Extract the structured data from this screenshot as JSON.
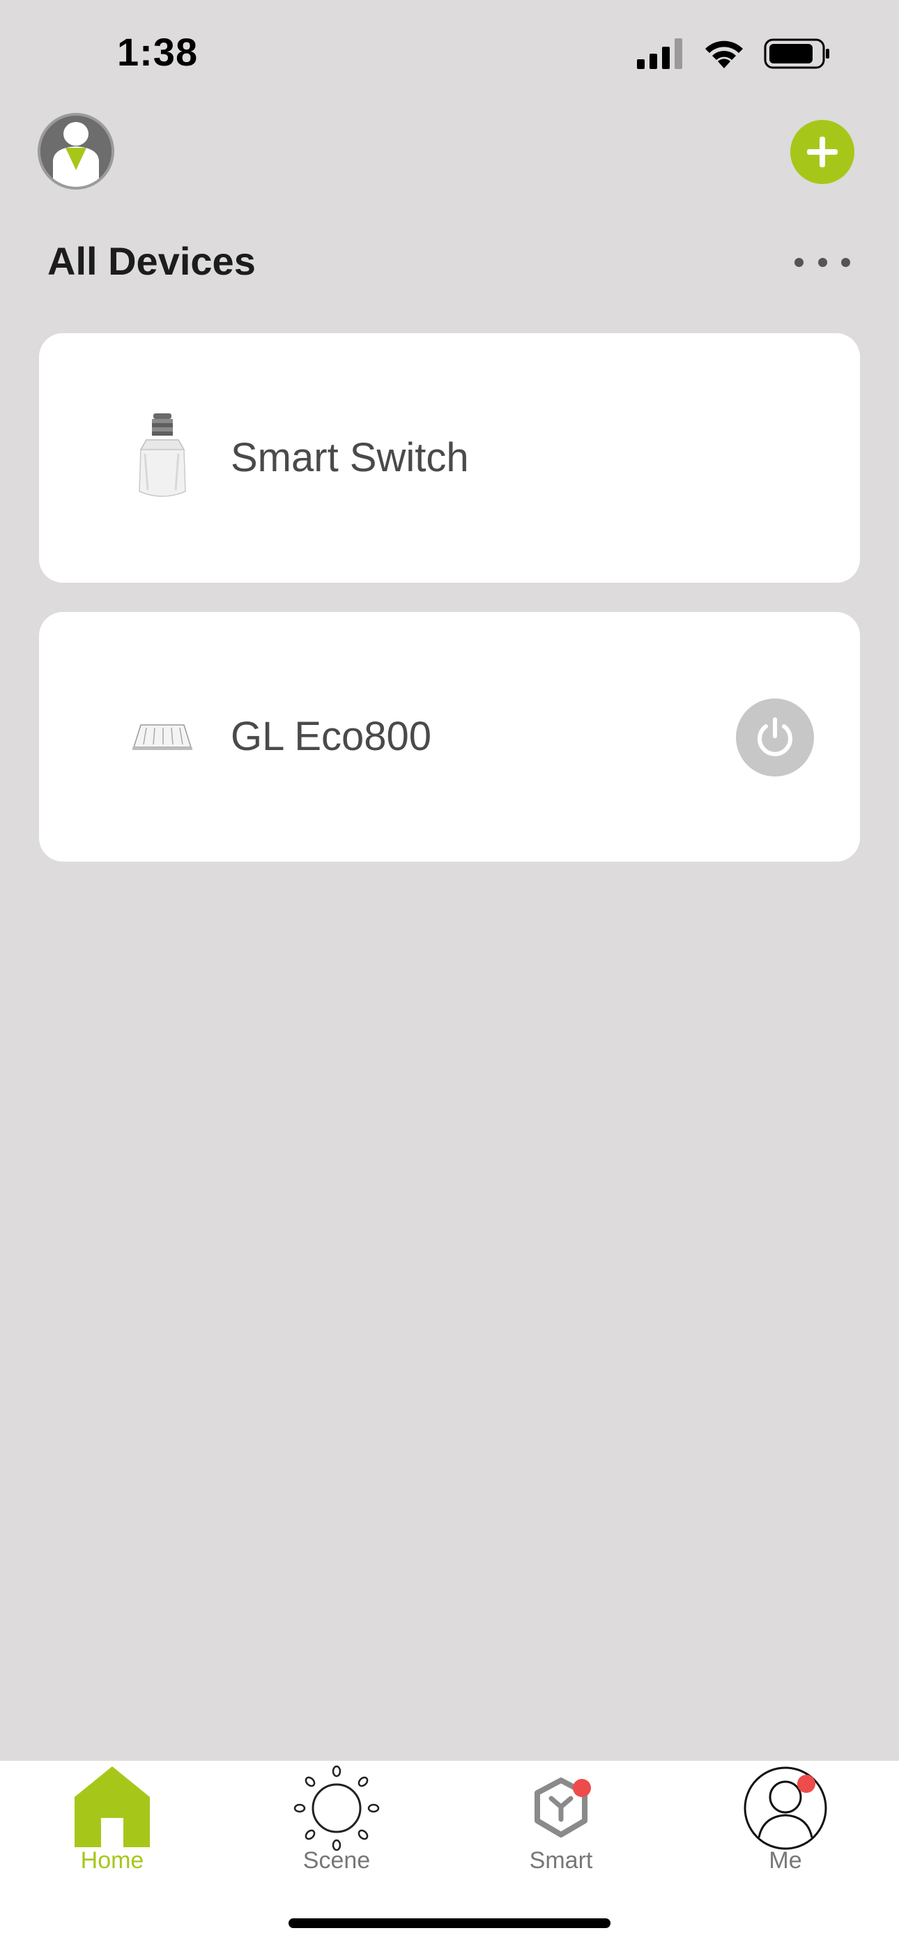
{
  "status_bar": {
    "time": "1:38"
  },
  "header": {
    "title": "All Devices",
    "avatar_icon": "user-avatar-icon",
    "add_icon": "plus-icon",
    "more_icon": "more-dots-icon"
  },
  "devices": [
    {
      "name": "Smart Switch",
      "icon": "bulb-socket-icon",
      "has_power_button": false
    },
    {
      "name": "GL Eco800",
      "icon": "ceiling-light-icon",
      "has_power_button": true
    }
  ],
  "tabs": [
    {
      "label": "Home",
      "icon": "home-icon",
      "active": true
    },
    {
      "label": "Scene",
      "icon": "sun-icon",
      "active": false
    },
    {
      "label": "Smart",
      "icon": "cube-icon",
      "active": false,
      "badge": true
    },
    {
      "label": "Me",
      "icon": "profile-icon",
      "active": false,
      "badge": true
    }
  ],
  "colors": {
    "accent": "#a6c71a",
    "background": "#dddbdc",
    "card": "#ffffff",
    "badge": "#ee4b4b",
    "power_button": "#c7c7c7"
  }
}
